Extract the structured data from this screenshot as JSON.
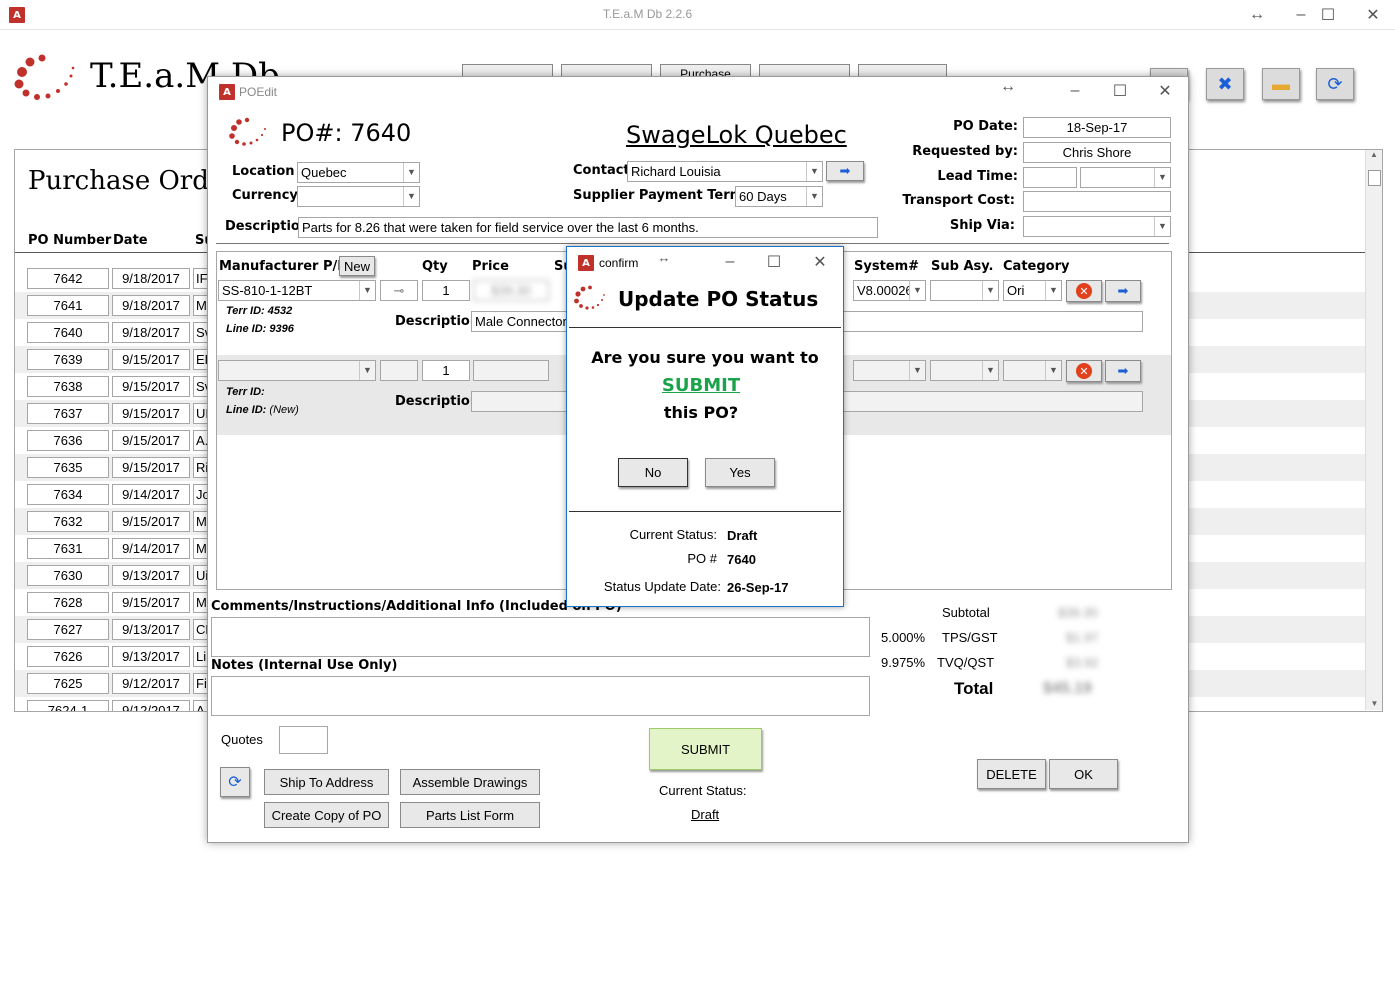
{
  "app": {
    "title": "T.E.a.M Db 2.2.6",
    "logo_text": "T.E.a.M Db",
    "page_heading": "Purchase Orde",
    "top_tabs": [
      "",
      "",
      "Purchase",
      "",
      ""
    ],
    "columns": {
      "po_number": "PO Number",
      "date": "Date",
      "supplier": "Su"
    },
    "rows": [
      {
        "po": "7642",
        "date": "9/18/2017",
        "sup": "IF"
      },
      {
        "po": "7641",
        "date": "9/18/2017",
        "sup": "M"
      },
      {
        "po": "7640",
        "date": "9/18/2017",
        "sup": "Sv"
      },
      {
        "po": "7639",
        "date": "9/15/2017",
        "sup": "EF"
      },
      {
        "po": "7638",
        "date": "9/15/2017",
        "sup": "Sv"
      },
      {
        "po": "7637",
        "date": "9/15/2017",
        "sup": "UI"
      },
      {
        "po": "7636",
        "date": "9/15/2017",
        "sup": "A."
      },
      {
        "po": "7635",
        "date": "9/15/2017",
        "sup": "Ri"
      },
      {
        "po": "7634",
        "date": "9/14/2017",
        "sup": "Jo"
      },
      {
        "po": "7632",
        "date": "9/15/2017",
        "sup": "M"
      },
      {
        "po": "7631",
        "date": "9/14/2017",
        "sup": "M"
      },
      {
        "po": "7630",
        "date": "9/13/2017",
        "sup": "Ui"
      },
      {
        "po": "7628",
        "date": "9/15/2017",
        "sup": "M"
      },
      {
        "po": "7627",
        "date": "9/13/2017",
        "sup": "CL"
      },
      {
        "po": "7626",
        "date": "9/13/2017",
        "sup": "Li"
      },
      {
        "po": "7625",
        "date": "9/12/2017",
        "sup": "Fi"
      },
      {
        "po": "7624-1",
        "date": "9/12/2017",
        "sup": "A"
      }
    ]
  },
  "poedit": {
    "title": "POEdit",
    "po_label": "PO#: 7640",
    "supplier_name": "SwageLok Quebec",
    "location_label": "Location",
    "location_value": "Quebec",
    "currency_label": "Currency",
    "currency_value": "",
    "contact_label": "Contact",
    "contact_value": "Richard Louisia",
    "terms_label": "Supplier Payment Terms:",
    "terms_value": "60 Days",
    "description_label": "Description",
    "description_value": "Parts for 8.26 that were taken for field service over the last 6 months.",
    "po_date_label": "PO Date:",
    "po_date_value": "18-Sep-17",
    "requested_label": "Requested by:",
    "requested_value": "Chris Shore",
    "lead_label": "Lead Time:",
    "transport_label": "Transport Cost:",
    "ship_label": "Ship Via:",
    "lines_header": {
      "mpn": "Manufacturer P/N",
      "new": "New",
      "qty": "Qty",
      "price": "Price",
      "su": "Su",
      "system": "System#",
      "subasy": "Sub Asy.",
      "category": "Category"
    },
    "line1": {
      "mpn": "SS-810-1-12BT",
      "qty": "1",
      "price": "$39.30",
      "system": "V8.00026",
      "category": "Ori",
      "terr": "Terr ID: 4532",
      "lineid": "Line ID: 9396",
      "desc_label": "Description",
      "desc": "Male Connector"
    },
    "line2": {
      "qty": "1",
      "terr": "Terr ID:",
      "lineid_label": "Line ID:",
      "lineid_value": "(New)",
      "desc_label": "Description"
    },
    "comments_label": "Comments/Instructions/Additional Info (Included on PO)",
    "notes_label": "Notes (Internal Use Only)",
    "subtotal_label": "Subtotal",
    "subtotal_value": "$39.30",
    "tps_rate": "5.000%",
    "tps_label": "TPS/GST",
    "tps_value": "$1.97",
    "tvq_rate": "9.975%",
    "tvq_label": "TVQ/QST",
    "tvq_value": "$3.92",
    "total_label": "Total",
    "total_value": "$45.19",
    "quotes_label": "Quotes",
    "ship_to": "Ship To Address",
    "assemble": "Assemble Drawings",
    "copy_po": "Create Copy of PO",
    "parts_list": "Parts List Form",
    "submit": "SUBMIT",
    "current_status_label": "Current Status:",
    "current_status_value": "Draft",
    "delete": "DELETE",
    "ok": "OK"
  },
  "confirm": {
    "title": "confirm",
    "heading": "Update PO Status",
    "question_line1": "Are you sure you want to",
    "action": "SUBMIT",
    "question_line3": "this PO?",
    "no": "No",
    "yes": "Yes",
    "status_label": "Current Status:",
    "status_value": "Draft",
    "po_label": "PO #",
    "po_value": "7640",
    "date_label": "Status Update Date:",
    "date_value": "26-Sep-17"
  },
  "colors": {
    "accent_red": "#c0312b",
    "submit_green": "#1aa34a",
    "submit_bg": "#e3f5c8"
  }
}
